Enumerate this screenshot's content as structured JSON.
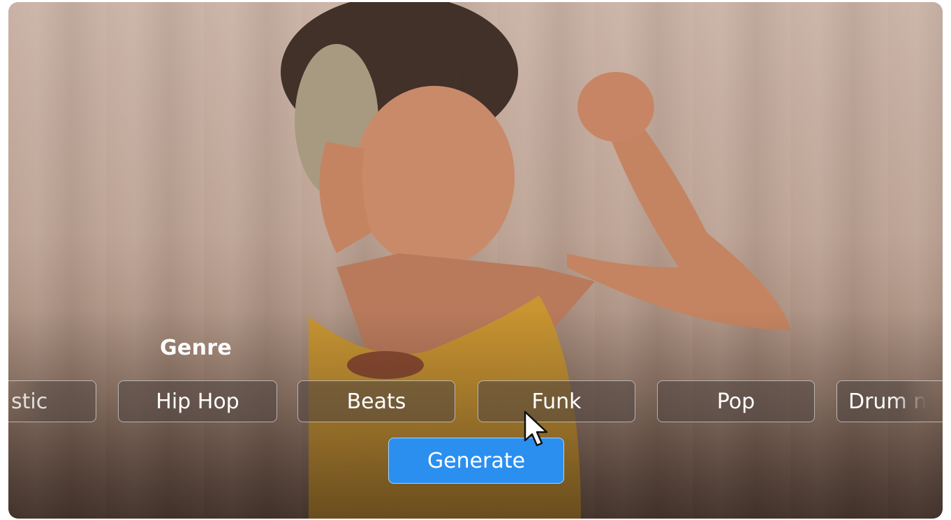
{
  "genre": {
    "title": "Genre",
    "chips": [
      {
        "label": "stic",
        "state": "partial-left"
      },
      {
        "label": "Hip Hop",
        "state": "normal"
      },
      {
        "label": "Beats",
        "state": "normal"
      },
      {
        "label": "Funk",
        "state": "hovered"
      },
      {
        "label": "Pop",
        "state": "normal"
      },
      {
        "label": "Drum n",
        "state": "partial-right"
      }
    ]
  },
  "generate": {
    "label": "Generate"
  },
  "colors": {
    "accent": "#2b8ff0",
    "chip_bg": "#504642",
    "text": "#ffffff"
  },
  "icons": {
    "cursor": "mouse-pointer-icon"
  }
}
